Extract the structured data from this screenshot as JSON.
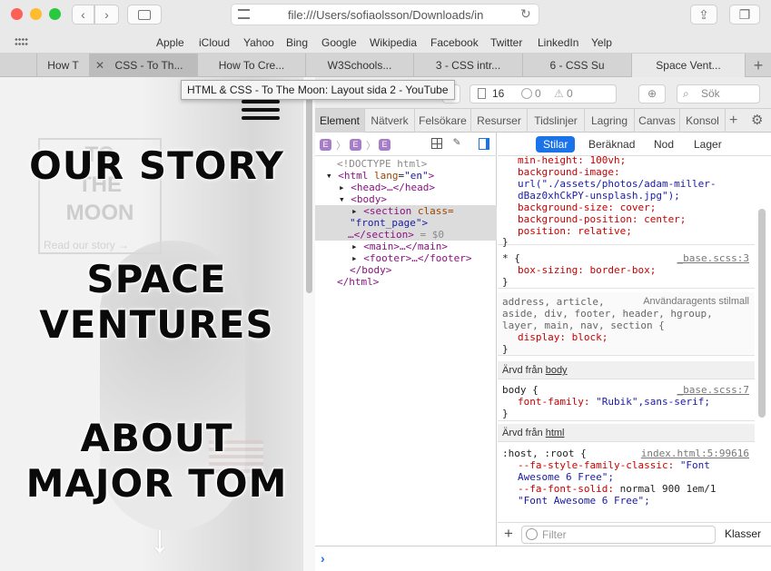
{
  "window": {
    "url": "file:///Users/sofiaolsson/Downloads/in",
    "favorites": [
      "Apple",
      "iCloud",
      "Yahoo",
      "Bing",
      "Google",
      "Wikipedia",
      "Facebook",
      "Twitter",
      "LinkedIn",
      "Yelp"
    ],
    "tabs": [
      "How T",
      "CSS - To Th...",
      "How To Cre...",
      "W3Schools...",
      "3 - CSS intr...",
      "6 - CSS Su",
      "Space Vent..."
    ],
    "tooltip": "HTML & CSS - To The Moon: Layout sida 2 - YouTube"
  },
  "page": {
    "logo_lines": [
      "TO",
      "THE",
      "MOON"
    ],
    "read_more": "Read our story →",
    "headings": [
      "OUR STORY",
      "SPACE",
      "VENTURES",
      "ABOUT",
      "MAJOR TOM"
    ],
    "arrow": "↓"
  },
  "devtools": {
    "resource_count": "16",
    "errors": "0",
    "warnings": "0",
    "search_placeholder": "Sök",
    "tabs": [
      "Element",
      "Nätverk",
      "Felsökare",
      "Resurser",
      "Tidslinjer",
      "Lagring",
      "Canvas",
      "Konsol"
    ],
    "style_tabs": [
      "Stilar",
      "Beräknad",
      "Nod",
      "Lager"
    ],
    "filter_placeholder": "Filter",
    "classes_label": "Klasser",
    "tree": {
      "doctype": "<!DOCTYPE html>",
      "html_open": "<html",
      "html_attr": "lang",
      "html_val": "\"en\"",
      "head": "<head>…</head>",
      "body_open": "<body>",
      "section_open": "<section",
      "section_attr": "class=",
      "section_val": "\"front_page\">",
      "section_close": "…</section>",
      "section_eq": "= $0",
      "main": "<main>…</main>",
      "footer": "<footer>…</footer>",
      "body_close": "</body>",
      "html_close": "</html>"
    },
    "styles": {
      "rule1": [
        "min-height: 100vh;",
        "background-image:",
        "url(\"./assets/photos/adam-miller-",
        "dBaz0xhCkPY-unsplash.jpg\");",
        "background-size: cover;",
        "background-position: center;",
        "position: relative;"
      ],
      "rule2_sel": "* {",
      "rule2_src": "_base.scss:3",
      "rule2_prop": "box-sizing: border-box;",
      "rule3_sel1": "address, article,",
      "rule3_src": "Användaragents stilmall",
      "rule3_sel2": "aside, div, footer, header, hgroup,",
      "rule3_sel3": "layer, main, nav, section {",
      "rule3_prop": "display: block;",
      "inh_body_label": "Ärvd från",
      "inh_body_link": "body",
      "rule4_sel": "body {",
      "rule4_src": "_base.scss:7",
      "rule4_prop": "font-family:",
      "rule4_val": "\"Rubik\",sans-serif;",
      "inh_html_label": "Ärvd från",
      "inh_html_link": "html",
      "rule5_sel": ":host, :root {",
      "rule5_src": "index.html:5:99616",
      "rule5_p1": "--fa-style-family-classic:",
      "rule5_v1": "\"Font",
      "rule5_v1b": "Awesome 6 Free\";",
      "rule5_p2": "--fa-font-solid:",
      "rule5_v2": "normal 900 1em/1",
      "rule5_v2b": "\"Font Awesome 6 Free\";"
    }
  }
}
